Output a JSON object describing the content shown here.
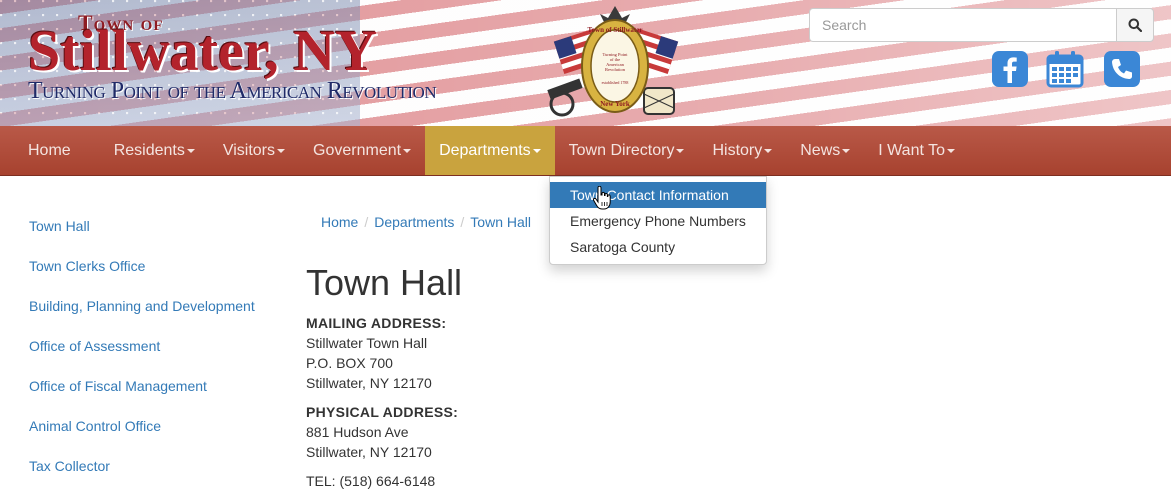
{
  "header": {
    "logo_top": "Town of",
    "logo_main": "Stillwater, NY",
    "logo_tagline": "Turning Point of the American Revolution",
    "seal_text_top": "Town of Stillwater",
    "seal_text_center_1": "Turning Point",
    "seal_text_center_2": "of the",
    "seal_text_center_3": "American",
    "seal_text_center_4": "Revolution",
    "seal_text_est": "established 1788",
    "seal_text_bottom": "New York",
    "search_placeholder": "Search",
    "colors": {
      "red": "#b3232c",
      "navy": "#1f2a68",
      "icon_blue": "#3b87d6"
    }
  },
  "nav": {
    "items": [
      {
        "label": "Home",
        "has_caret": false
      },
      {
        "label": "Residents",
        "has_caret": true
      },
      {
        "label": "Visitors",
        "has_caret": true
      },
      {
        "label": "Government",
        "has_caret": true
      },
      {
        "label": "Departments",
        "has_caret": true,
        "active": true
      },
      {
        "label": "Town Directory",
        "has_caret": true
      },
      {
        "label": "History",
        "has_caret": true
      },
      {
        "label": "News",
        "has_caret": true
      },
      {
        "label": "I Want To",
        "has_caret": true
      }
    ],
    "colors": {
      "bar": "#a7422f",
      "active": "#c9a33e"
    }
  },
  "dropdown": {
    "items": [
      {
        "label": "Town Contact Information",
        "hover": true
      },
      {
        "label": "Emergency Phone Numbers"
      },
      {
        "label": "Saratoga County"
      }
    ]
  },
  "sidebar": {
    "items": [
      {
        "label": "Town Hall"
      },
      {
        "label": "Town Clerks Office"
      },
      {
        "label": "Building, Planning and Development"
      },
      {
        "label": "Office of Assessment"
      },
      {
        "label": "Office of Fiscal Management"
      },
      {
        "label": "Animal Control Office"
      },
      {
        "label": "Tax Collector"
      }
    ]
  },
  "breadcrumb": [
    "Home",
    "Departments",
    "Town Hall"
  ],
  "main": {
    "title": "Town Hall",
    "mailing_label": "MAILING ADDRESS:",
    "mailing_line1": "Stillwater Town Hall",
    "mailing_line2": "P.O. BOX 700",
    "mailing_line3": "Stillwater, NY 12170",
    "physical_label": "PHYSICAL ADDRESS:",
    "physical_line1": "881 Hudson Ave",
    "physical_line2": "Stillwater, NY 12170",
    "tel": "TEL: (518) 664-6148"
  }
}
